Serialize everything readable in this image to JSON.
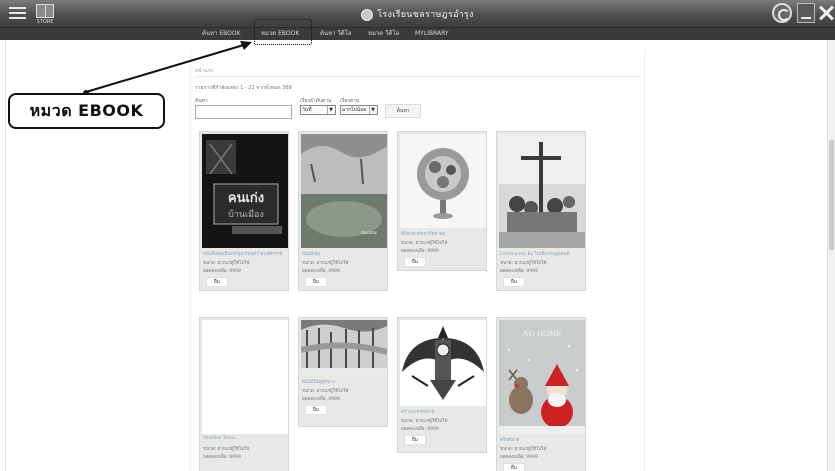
{
  "titlebar": {
    "title": "โรงเรียนชลราษฎรอำรุง",
    "store_label": "STORE"
  },
  "nav": {
    "items": [
      "ค้นหา EBOOK",
      "หมวด EBOOK",
      "ค้นหา วีดีโอ",
      "หมวด วีดีโอ",
      "MYLIBRARY"
    ]
  },
  "callout": {
    "text": "หมวด EBOOK"
  },
  "breadcrumb": "หน้าแรก",
  "summary": "รายการที่กำลังแสดง 1 - 22 จากทั้งหมด 369",
  "search": {
    "label": "ค้นหา",
    "value": "",
    "sort_label": "เรียงลำดับตาม",
    "sort_value": "วันที่",
    "order_label": "เรียงตาม",
    "order_value": "มากไปน้อย",
    "button": "ค้นหา"
  },
  "books": [
    {
      "title": "หนังสือคนเมืองลำพูนเรียนลำไยมหัศจรรย์",
      "size": "ขนาด: ยากแก่ผู้ใช้ไม่ใช่",
      "views": "ยอดคงเหลือ: 9999",
      "button": "ยืม",
      "cover": "dark-bw-lettering"
    },
    {
      "title": "ปัณณ์ณัฐ",
      "size": "ขนาด: ยากแก่ผู้ใช้ไม่ใช่",
      "views": "ยอดคงเหลือ: 9999",
      "button": "ยืม",
      "cover": "landscape-field"
    },
    {
      "title": "พิพิธภัณฑ์มหาวิทยาลัย",
      "size": "ขนาด: ยากแก่ผู้ใช้ไม่ใช่",
      "views": "ยอดคงเหลือ: 9999",
      "button": "ยืม",
      "cover": "ornament-tree"
    },
    {
      "title": "Community By ไปเที่ยวกับลูกคนดี",
      "size": "ขนาด: ยากแก่ผู้ใช้ไม่ใช่",
      "views": "ยอดคงเหลือ: 9999",
      "button": "ยืม",
      "cover": "people-cross"
    },
    {
      "title": "Mobilize Takes",
      "size": "ขนาด: ยากแก่ผู้ใช้ไม่ใช่",
      "views": "ยอดคงเหลือ: 9999",
      "button": "ยืม",
      "cover": "blank"
    },
    {
      "title": "ต้นไม้ในฤดูหนาว",
      "size": "ขนาด: ยากแก่ผู้ใช้ไม่ใช่",
      "views": "ยอดคงเหลือ: 9999",
      "button": "ยืม",
      "cover": "snow-trees"
    },
    {
      "title": "ตราพระครุฑพ่าห์",
      "size": "ขนาด: ยากแก่ผู้ใช้ไม่ใช่",
      "views": "ยอดคงเหลือ: 9999",
      "button": "ยืม",
      "cover": "garuda"
    },
    {
      "title": "คริสต์มาส",
      "size": "ขนาด: ยากแก่ผู้ใช้ไม่ใช่",
      "views": "ยอดคงเหลือ: 9999",
      "button": "ยืม",
      "cover": "christmas",
      "cover_text": "NO HOME"
    }
  ]
}
